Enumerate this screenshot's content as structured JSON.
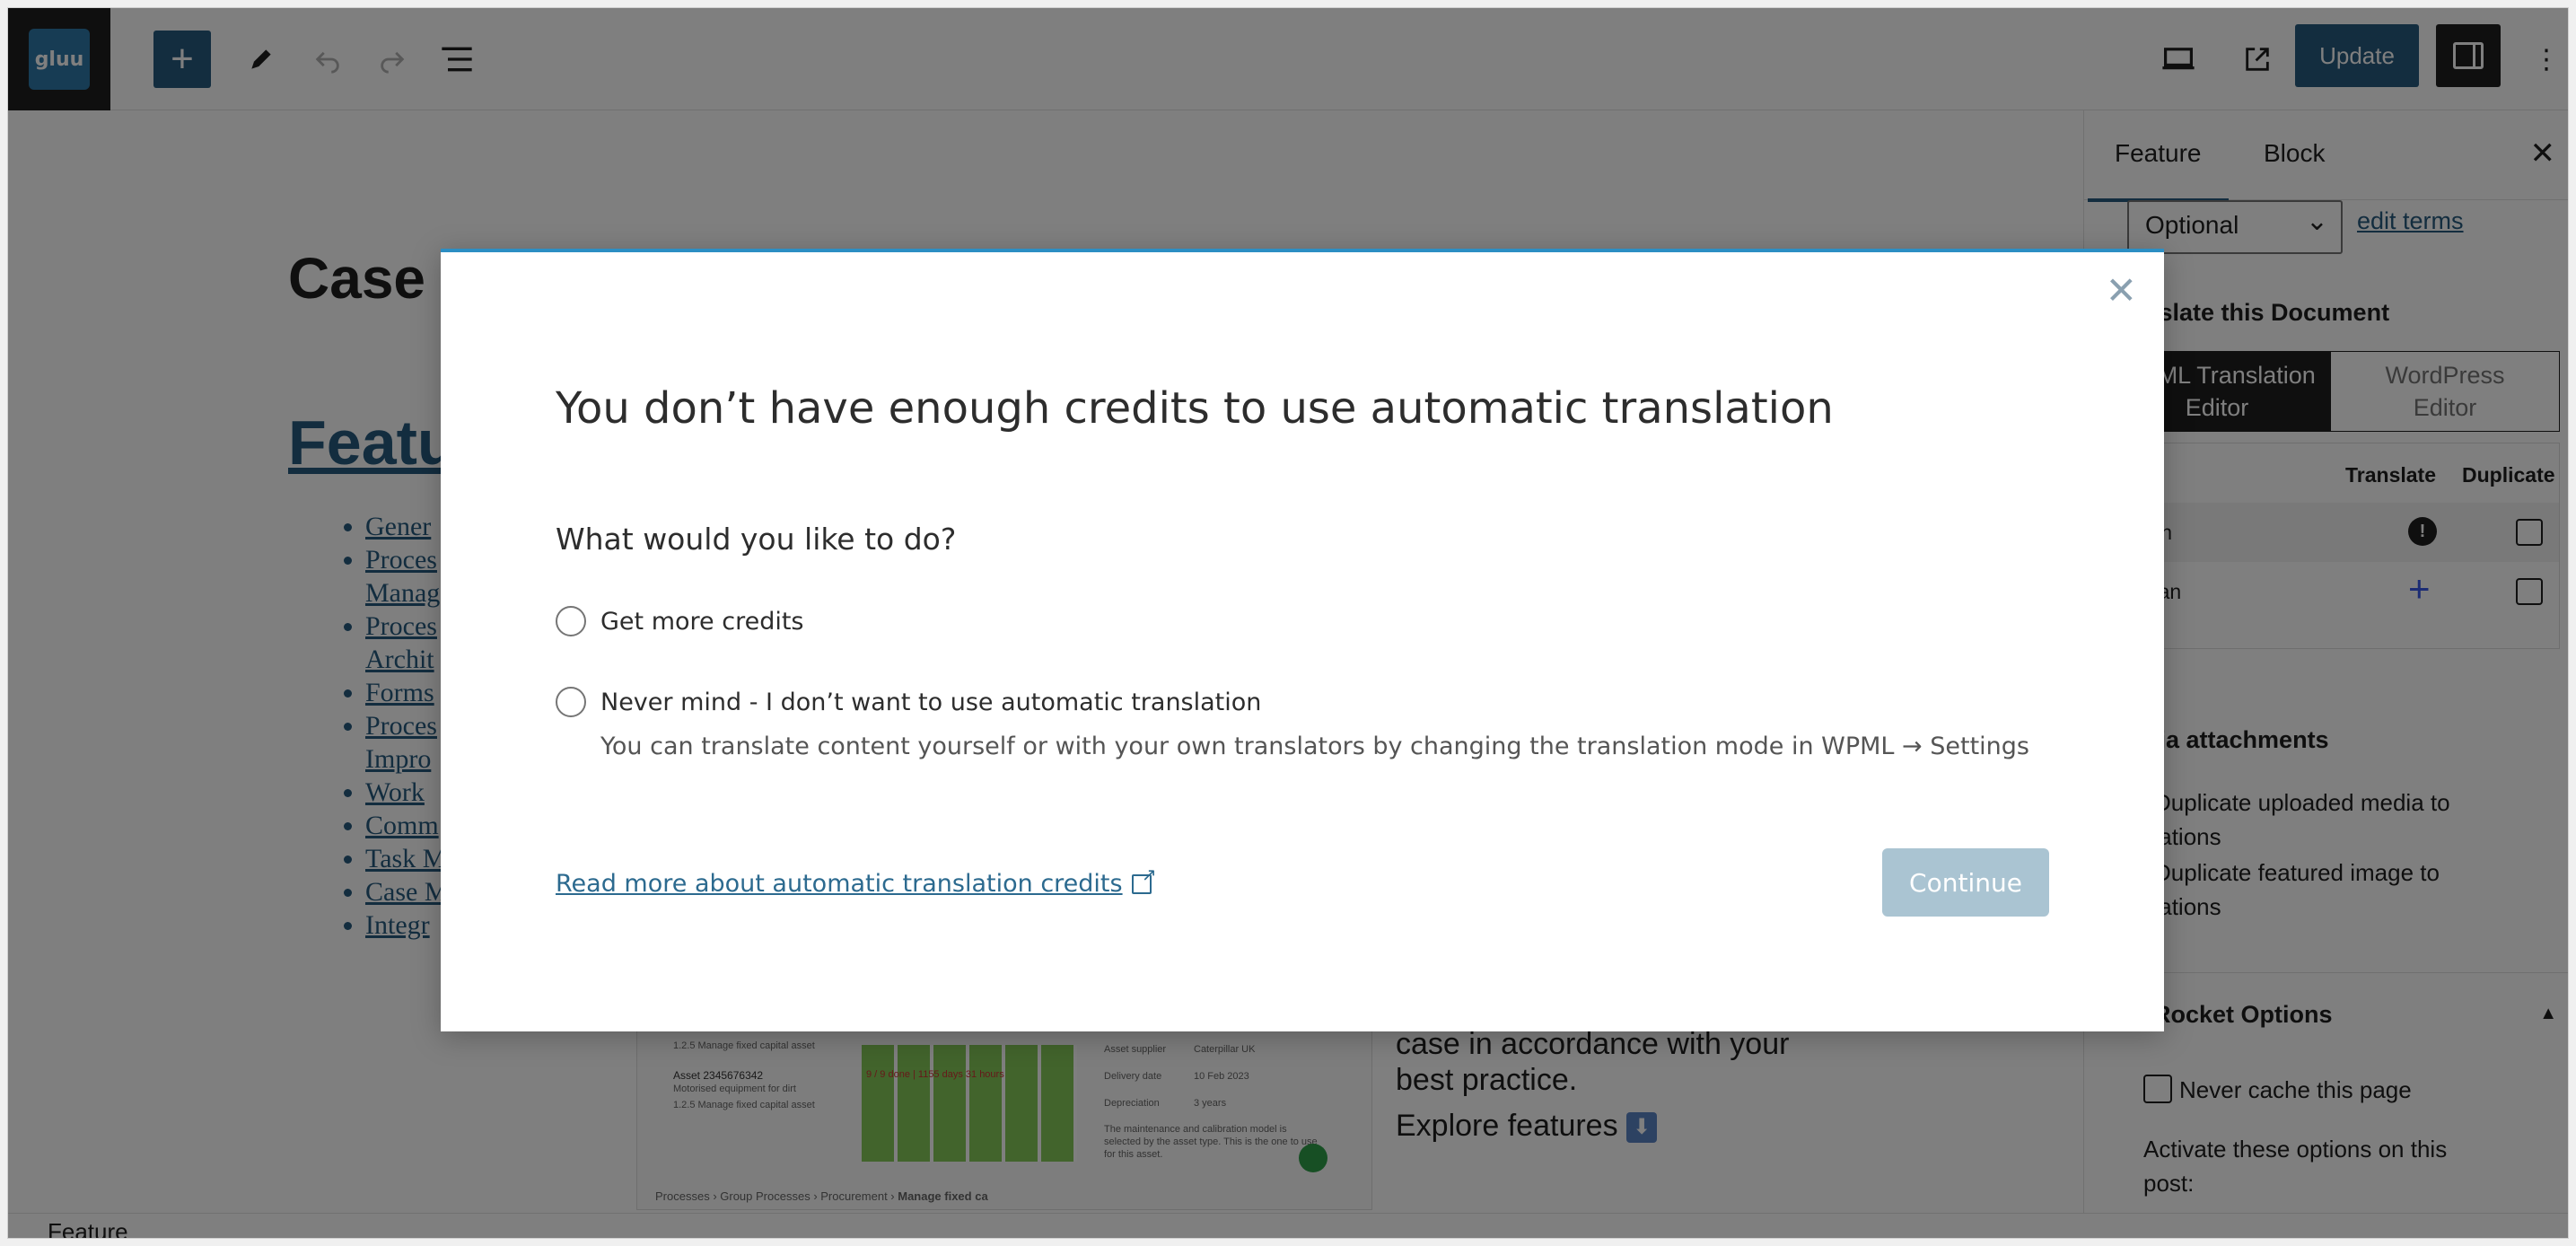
{
  "app": {
    "logo_text": "gluu"
  },
  "toolbar": {
    "add_icon": "plus-icon",
    "tools_icon": "pencil-icon",
    "undo_icon": "undo-icon",
    "redo_icon": "redo-icon",
    "outline_icon": "list-view-icon",
    "preview_icon": "desktop-preview-icon",
    "view_post_icon": "external-link-icon",
    "update_label": "Update",
    "settings_icon": "sidebar-toggle-icon",
    "options_icon": "kebab-menu-icon"
  },
  "editor": {
    "doc_title": "Case",
    "features_heading": "Featu",
    "feature_items": [
      "Gener",
      "Proces",
      "Manag",
      "Proces",
      "Archit",
      "Forms",
      "Proces",
      "Impro",
      "Work",
      "Comm",
      "Task M",
      "Case M",
      "Integr"
    ],
    "body_text_line1": "case in accordance with your",
    "body_text_line2": "best practice.",
    "explore_text": "Explore features",
    "footer_text": "Feature",
    "mock_texts": {
      "row1": "1.2.5 Manage fixed capital asset",
      "asset_label": "Asset 2345676342",
      "asset_sub": "Motorised equipment for dirt",
      "progress": "9 / 9 done | 1155 days 31 hours",
      "row2": "1.2.5 Manage fixed capital asset",
      "supplier_k": "Asset supplier",
      "supplier_v": "Caterpillar UK",
      "delivery_k": "Delivery date",
      "delivery_v": "10 Feb 2023",
      "depr_k": "Depreciation",
      "depr_v": "3 years",
      "note": "The maintenance and calibration model is selected by the asset type. This is the one to use for this asset.",
      "crumb1": "Processes",
      "crumb2": "Group Processes",
      "crumb3": "Procurement",
      "crumb4": "Manage fixed ca"
    }
  },
  "sidebar": {
    "tabs": [
      "Feature",
      "Block"
    ],
    "close_icon": "close-icon",
    "select_value": "Optional",
    "edit_terms": "edit terms",
    "translate_heading": "anslate this Document",
    "editor_options": [
      [
        "WPML Translation",
        "Editor"
      ],
      [
        "WordPress",
        "Editor"
      ]
    ],
    "col_translate": "Translate",
    "col_duplicate": "Duplicate",
    "languages": [
      "anish",
      "erman"
    ],
    "media_heading": "edia attachments",
    "media_line1a": "Duplicate uploaded media to",
    "media_line1b": "nslations",
    "media_line2a": "Duplicate featured image to",
    "media_line2b": "nslations",
    "rocket_heading": "P Rocket Options",
    "never_cache": "Never cache this page",
    "activate_text1": "Activate these options on this",
    "activate_text2": "post:"
  },
  "modal": {
    "title": "You don’t have enough credits to use automatic translation",
    "question": "What would you like to do?",
    "option1": "Get more credits",
    "option2": "Never mind - I don’t want to use automatic translation",
    "option2_hint": "You can translate content yourself or with your own translators by changing the translation mode in WPML → Settings",
    "read_more": "Read more about automatic translation credits",
    "continue_label": "Continue"
  },
  "colors": {
    "primary": "#265a7e",
    "modal_accent": "#2c8ec3",
    "continue_disabled": "#aac4d2",
    "link": "#2c6a8f"
  }
}
